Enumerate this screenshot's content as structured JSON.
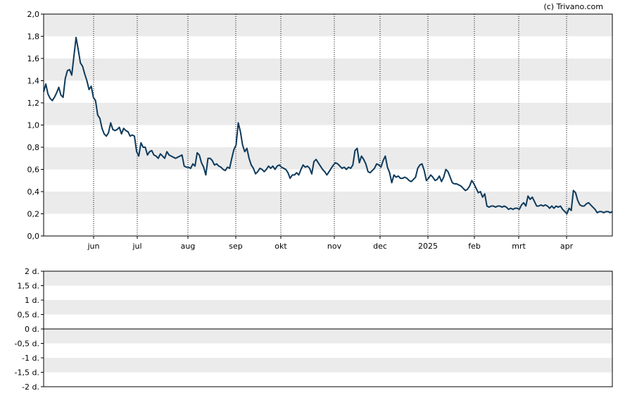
{
  "copyright": "(c) Trivano.com",
  "chart_data": [
    {
      "type": "line",
      "ylim": [
        0,
        2.0
      ],
      "y_ticks": [
        "0,0",
        "0,2",
        "0,4",
        "0,6",
        "0,8",
        "1,0",
        "1,2",
        "1,4",
        "1,6",
        "1,8",
        "2,0"
      ],
      "x_ticks": [
        "jun",
        "jul",
        "aug",
        "sep",
        "okt",
        "nov",
        "dec",
        "2025",
        "feb",
        "mrt",
        "apr"
      ],
      "grid": "alternating horizontal bands, dotted vertical lines at month ticks",
      "line_color": "#0d3a5c",
      "series": [
        {
          "values": [
            1.3,
            1.37,
            1.28,
            1.24,
            1.22,
            1.25,
            1.29,
            1.34,
            1.27,
            1.25,
            1.42,
            1.49,
            1.5,
            1.45,
            1.62,
            1.79,
            1.68,
            1.56,
            1.53,
            1.46,
            1.4,
            1.32,
            1.35,
            1.25,
            1.22,
            1.09,
            1.06,
            0.97,
            0.92,
            0.9,
            0.93,
            1.02,
            0.96,
            0.95,
            0.96,
            0.98,
            0.92,
            0.97,
            0.95,
            0.94,
            0.9,
            0.91,
            0.9,
            0.76,
            0.72,
            0.84,
            0.8,
            0.8,
            0.73,
            0.76,
            0.77,
            0.73,
            0.72,
            0.7,
            0.74,
            0.72,
            0.7,
            0.76,
            0.73,
            0.72,
            0.71,
            0.7,
            0.71,
            0.72,
            0.73,
            0.63,
            0.62,
            0.62,
            0.61,
            0.65,
            0.63,
            0.75,
            0.73,
            0.66,
            0.62,
            0.55,
            0.7,
            0.7,
            0.68,
            0.64,
            0.65,
            0.63,
            0.62,
            0.6,
            0.59,
            0.62,
            0.61,
            0.7,
            0.78,
            0.82,
            1.02,
            0.94,
            0.82,
            0.76,
            0.79,
            0.7,
            0.64,
            0.61,
            0.56,
            0.58,
            0.61,
            0.6,
            0.58,
            0.6,
            0.63,
            0.61,
            0.63,
            0.6,
            0.63,
            0.64,
            0.62,
            0.61,
            0.6,
            0.57,
            0.52,
            0.55,
            0.55,
            0.57,
            0.55,
            0.6,
            0.64,
            0.62,
            0.63,
            0.61,
            0.56,
            0.67,
            0.69,
            0.66,
            0.63,
            0.6,
            0.58,
            0.55,
            0.58,
            0.61,
            0.64,
            0.66,
            0.65,
            0.63,
            0.61,
            0.62,
            0.6,
            0.62,
            0.61,
            0.64,
            0.77,
            0.79,
            0.66,
            0.72,
            0.69,
            0.65,
            0.58,
            0.57,
            0.59,
            0.61,
            0.65,
            0.64,
            0.62,
            0.68,
            0.72,
            0.62,
            0.57,
            0.48,
            0.55,
            0.53,
            0.54,
            0.52,
            0.52,
            0.53,
            0.52,
            0.5,
            0.49,
            0.51,
            0.53,
            0.61,
            0.64,
            0.65,
            0.59,
            0.5,
            0.52,
            0.55,
            0.53,
            0.5,
            0.51,
            0.54,
            0.49,
            0.53,
            0.6,
            0.58,
            0.53,
            0.48,
            0.47,
            0.47,
            0.46,
            0.45,
            0.43,
            0.41,
            0.42,
            0.45,
            0.5,
            0.47,
            0.43,
            0.39,
            0.4,
            0.35,
            0.38,
            0.27,
            0.26,
            0.27,
            0.27,
            0.26,
            0.27,
            0.27,
            0.26,
            0.27,
            0.26,
            0.24,
            0.25,
            0.24,
            0.25,
            0.25,
            0.24,
            0.28,
            0.3,
            0.27,
            0.36,
            0.33,
            0.35,
            0.31,
            0.27,
            0.27,
            0.28,
            0.27,
            0.28,
            0.27,
            0.25,
            0.27,
            0.25,
            0.27,
            0.26,
            0.27,
            0.24,
            0.22,
            0.2,
            0.25,
            0.23,
            0.41,
            0.39,
            0.32,
            0.28,
            0.27,
            0.27,
            0.29,
            0.3,
            0.28,
            0.26,
            0.24,
            0.21,
            0.22,
            0.22,
            0.21,
            0.22,
            0.22,
            0.21,
            0.22
          ]
        }
      ]
    },
    {
      "type": "line",
      "ylim": [
        -2,
        2
      ],
      "y_ticks": [
        "2 d.",
        "1,5 d.",
        "1 d.",
        "0,5 d.",
        "0 d.",
        "-0,5 d.",
        "-1 d.",
        "-1,5 d.",
        "-2 d."
      ],
      "x_ticks": [],
      "grid": "alternating horizontal bands",
      "series": []
    }
  ]
}
